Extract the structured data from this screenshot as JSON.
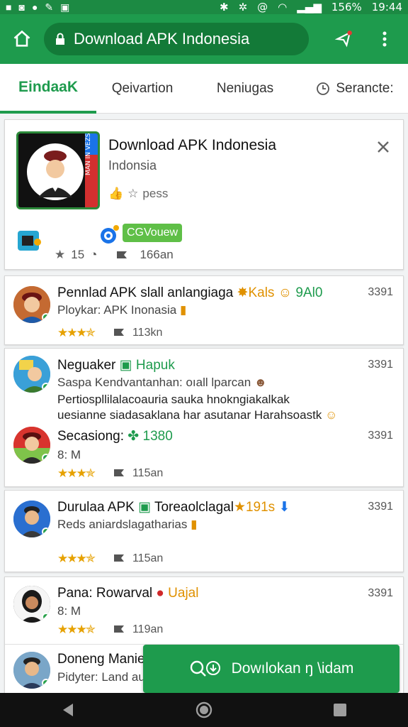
{
  "status": {
    "battery": "156%",
    "time": "19:44"
  },
  "toolbar": {
    "url": "Download APK Indonesia"
  },
  "tabs": [
    "EindaaK",
    "Qeivartion",
    "Neniugas",
    "Serancte:"
  ],
  "featured": {
    "title": "Download APK Indonesia",
    "subtitle": "Indonsia",
    "press": "pess",
    "tag": "CGVouew",
    "rating": "15",
    "size": "166an",
    "icon_text": "MAN IN VEZS"
  },
  "items": [
    {
      "title": "Pennlad APK slall anlangiaga",
      "badge": "Kals",
      "badge2": "9Al0",
      "sub": "Ploykar: APK Inonasia",
      "count": "3391",
      "size": "113kn"
    },
    {
      "title": "Neguaker",
      "badge": "Hapuk",
      "sub": "Saspa Kendvantanhan: oıall lparcan",
      "line2": "Pertiospllilalacoauria sauka hnokngiakalkak",
      "line3": "uesianne siadasaklana har asutanar Harahsoastk",
      "count": "3391"
    },
    {
      "title": "Secasiong:",
      "badge": "1380",
      "sub": "8: M",
      "count": "3391",
      "size": "115an"
    },
    {
      "title": "Durulaa APK",
      "badge": "Toreaolclagal",
      "badge2": "191s",
      "sub": "Reds aniardslagatharias",
      "count": "3391",
      "size": "115an"
    },
    {
      "title": "Pana: Rowarval",
      "badge": "Uajal",
      "sub": "8: M",
      "count": "3391",
      "size": "119an"
    },
    {
      "title": "Doneng Manie",
      "sub": "Pidyter: Land au"
    }
  ],
  "fab": {
    "label": "Dowılokan ŋ \\idam"
  }
}
